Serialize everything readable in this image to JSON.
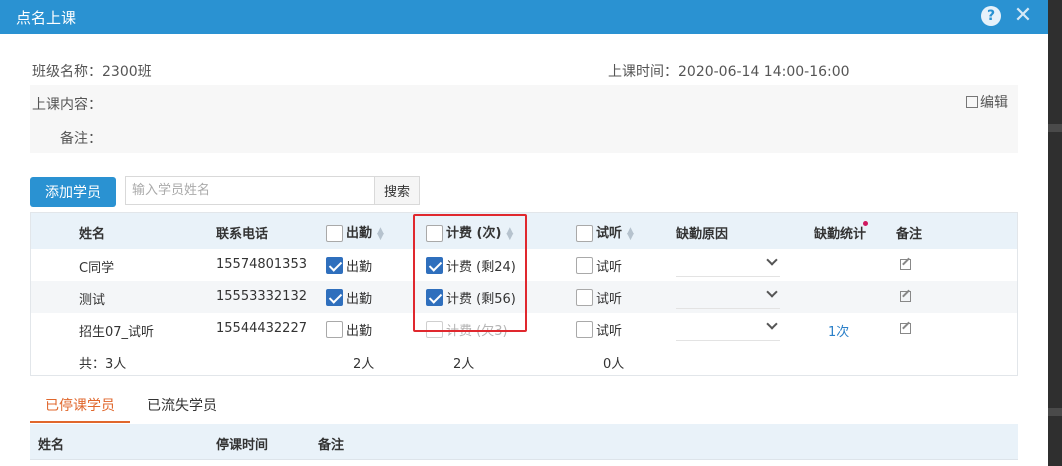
{
  "dialog": {
    "title": "点名上课"
  },
  "info": {
    "class_name": "班级名称：2300班",
    "time": "上课时间：2020-06-14   14:00-16:00",
    "content_label": "上课内容：",
    "remark_label": "备注：",
    "edit_label": "编辑"
  },
  "toolbar": {
    "add_label": "添加学员",
    "search_placeholder": "输入学员姓名",
    "search_button": "搜索"
  },
  "table": {
    "columns": {
      "name": "姓名",
      "phone": "联系电话",
      "attend": "出勤",
      "charge": "计费 (次)",
      "trial": "试听",
      "reason": "缺勤原因",
      "stats": "缺勤统计",
      "remark": "备注"
    },
    "rows": [
      {
        "name": "C同学",
        "phone": "15574801353",
        "attend": "出勤",
        "charge": "计费 (剩24)",
        "trial": "试听",
        "stats": ""
      },
      {
        "name": "测试",
        "phone": "15553332132",
        "attend": "出勤",
        "charge": "计费 (剩56)",
        "trial": "试听",
        "stats": ""
      },
      {
        "name": "招生07_试听",
        "phone": "15544432227",
        "attend": "出勤",
        "charge": "计费 (欠3)",
        "trial": "试听",
        "stats": "1次"
      }
    ],
    "footer": {
      "total": "共：3人",
      "attend_count": "2人",
      "charge_count": "2人",
      "trial_count": "0人"
    }
  },
  "tabs": [
    {
      "label": "已停课学员"
    },
    {
      "label": "已流失学员"
    }
  ],
  "suspended_table": {
    "columns": {
      "name": "姓名",
      "stop_time": "停课时间",
      "remark": "备注"
    }
  }
}
